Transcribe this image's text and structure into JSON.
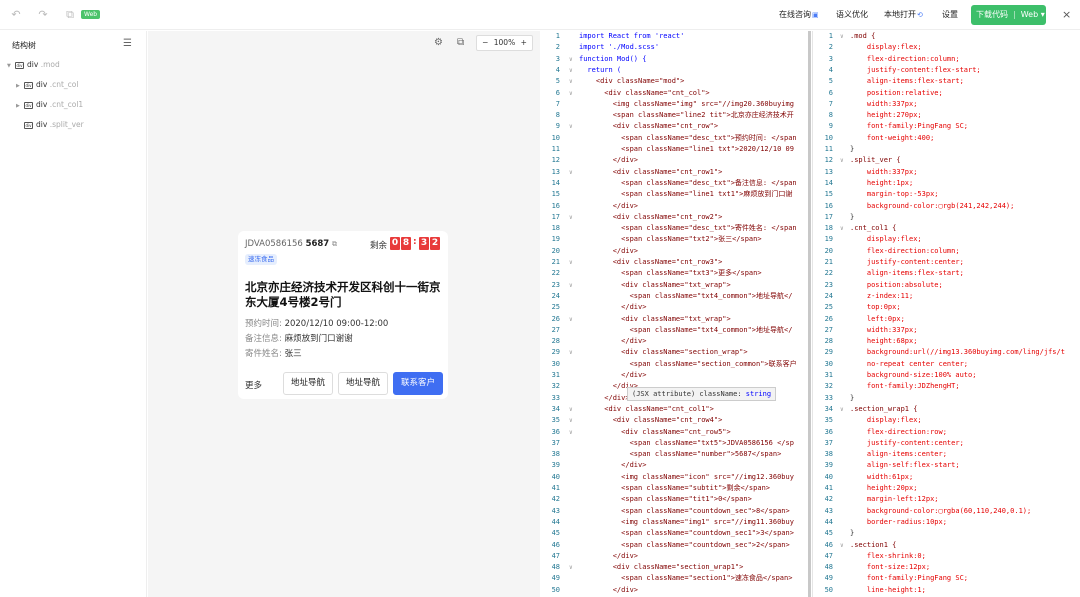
{
  "topbar": {
    "badge": "Web",
    "consult": "在线咨询",
    "semantic": "语义优化",
    "open_local": "本地打开",
    "settings": "设置",
    "download": "下载代码",
    "platform": "Web",
    "close": "×"
  },
  "tree": {
    "title": "结构树",
    "items": [
      {
        "label": "div",
        "cls": ".mod"
      },
      {
        "label": "div",
        "cls": ".cnt_col"
      },
      {
        "label": "div",
        "cls": ".cnt_col1"
      },
      {
        "label": "div",
        "cls": ".split_ver"
      }
    ]
  },
  "canvas": {
    "zoom": "100%",
    "zoom_minus": "−",
    "zoom_plus": "+"
  },
  "card": {
    "id_prefix": "JDVA0586156",
    "id_num": "5687",
    "remain_label": "剩余",
    "cd_h1": "0",
    "cd_h2": "8",
    "cd_m1": "3",
    "cd_m2": "2",
    "colon": ":",
    "tag": "速冻食品",
    "address": "北京亦庄经济技术开发区科创十一街京东大厦4号楼2号门",
    "time_label": "预约时间:",
    "time_value": "2020/12/10 09:00-12:00",
    "note_label": "备注信息:",
    "note_value": "麻烦放到门口谢谢",
    "sender_label": "寄件姓名:",
    "sender_value": "张三",
    "more": "更多",
    "nav1": "地址导航",
    "nav2": "地址导航",
    "contact": "联系客户"
  },
  "tooltip": {
    "prefix": "(JSX attribute) className:",
    "type": "string"
  },
  "jsx_lines": [
    "import React from 'react'",
    "import './Mod.scss'",
    "function Mod() {",
    "  return (",
    "    <div className=\"mod\">",
    "      <div className=\"cnt_col\">",
    "        <img className=\"img\" src=\"//img20.360buyimg",
    "        <span className=\"line2 tit\">北京亦庄经济技术开",
    "        <div className=\"cnt_row\">",
    "          <span className=\"desc_txt\">预约时间: </span",
    "          <span className=\"line1 txt\">2020/12/10 09",
    "        </div>",
    "        <div className=\"cnt_row1\">",
    "          <span className=\"desc_txt\">备注信息: </span",
    "          <span className=\"line1 txt1\">麻烦放到门口谢",
    "        </div>",
    "        <div className=\"cnt_row2\">",
    "          <span className=\"desc_txt\">寄件姓名: </span",
    "          <span className=\"txt2\">张三</span>",
    "        </div>",
    "        <div className=\"cnt_row3\">",
    "          <span className=\"txt3\">更多</span>",
    "          <div className=\"txt_wrap\">",
    "            <span className=\"txt4_common\">地址导航</",
    "          </div>",
    "          <div className=\"txt_wrap\">",
    "            <span className=\"txt4_common\">地址导航</",
    "          </div>",
    "          <div className=\"section_wrap\">",
    "            <span className=\"section_common\">联系客户",
    "          </div>",
    "        </div>",
    "      </div>",
    "      <div className=\"cnt_col1\">",
    "        <div className=\"cnt_row4\">",
    "          <div className=\"cnt_row5\">",
    "            <span className=\"txt5\">JDVA0586156 </sp",
    "            <span className=\"number\">5687</span>",
    "          </div>",
    "          <img className=\"icon\" src=\"//img12.360buy",
    "          <span className=\"subtit\">剩余</span>",
    "          <span className=\"tit1\">0</span>",
    "          <span className=\"countdown_sec\">8</span>",
    "          <img className=\"img1\" src=\"//img11.360buy",
    "          <span className=\"countdown_sec1\">3</span>",
    "          <span className=\"countdown_sec\">2</span>",
    "        </div>",
    "        <div className=\"section_wrap1\">",
    "          <span className=\"section1\">速冻食品</span>",
    "        </div>"
  ],
  "css_lines": [
    ".mod {",
    "    display:flex;",
    "    flex-direction:column;",
    "    justify-content:flex-start;",
    "    align-items:flex-start;",
    "    position:relative;",
    "    width:337px;",
    "    height:270px;",
    "    font-family:PingFang SC;",
    "    font-weight:400;",
    "}",
    ".split_ver {",
    "    width:337px;",
    "    height:1px;",
    "    margin-top:-53px;",
    "    background-color:▢rgb(241,242,244);",
    "}",
    ".cnt_col1 {",
    "    display:flex;",
    "    flex-direction:column;",
    "    justify-content:center;",
    "    align-items:flex-start;",
    "    position:absolute;",
    "    z-index:11;",
    "    top:0px;",
    "    left:0px;",
    "    width:337px;",
    "    height:68px;",
    "    background:url(//img13.360buyimg.com/ling/jfs/t",
    "    no-repeat center center;",
    "    background-size:100% auto;",
    "    font-family:JDZhengHT;",
    "}",
    ".section_wrap1 {",
    "    display:flex;",
    "    flex-direction:row;",
    "    justify-content:center;",
    "    align-items:center;",
    "    align-self:flex-start;",
    "    width:61px;",
    "    height:20px;",
    "    margin-left:12px;",
    "    background-color:▢rgba(60,110,240,0.1);",
    "    border-radius:10px;",
    "}",
    ".section1 {",
    "    flex-shrink:0;",
    "    font-size:12px;",
    "    font-family:PingFang SC;",
    "    line-height:1;"
  ]
}
